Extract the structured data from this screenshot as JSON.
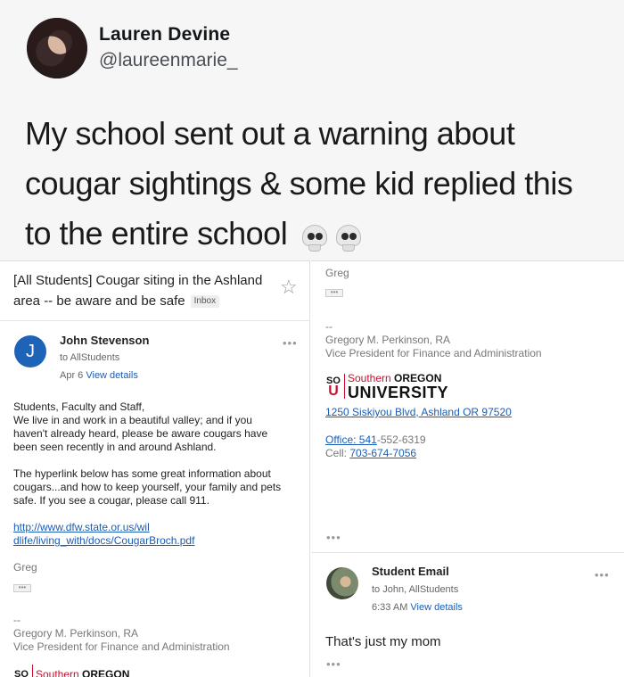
{
  "tweet": {
    "author_name": "Lauren Devine",
    "author_handle": "@laureenmarie_",
    "text_line1": "My school sent out a warning about",
    "text_line2": "cougar sightings & some kid replied this",
    "text_line3": "to the entire school",
    "emoji": "skull-emoji"
  },
  "email": {
    "subject": "[All Students] Cougar siting in the Ashland area -- be aware and be safe",
    "label": "Inbox",
    "sender_initial": "J",
    "sender_name": "John Stevenson",
    "to": "to AllStudents",
    "date": "Apr 6",
    "details_link": "View details",
    "body_p1": [
      "Students, Faculty and Staff,",
      "We live in and work in a beautiful valley; and if you",
      "haven't already heard, please be aware cougars have",
      "been seen recently in and around Ashland."
    ],
    "body_p2": [
      "The hyperlink below has some great information about",
      "cougars...and how to keep yourself, your family and pets",
      "safe.  If you see a cougar, please call 911."
    ],
    "url_line1": "http://www.dfw.state.or.us/wil",
    "url_line2": "dlife/living_with/docs/CougarBroch.pdf",
    "sign_off": "Greg",
    "sig_dash": "--",
    "sig_name": "Gregory M. Perkinson, RA",
    "sig_title": "Vice President for Finance and Administration",
    "logo_mark_top": "SO",
    "logo_mark_bottom": "U",
    "logo_line1_a": "Southern",
    "logo_line1_b": "OREGON",
    "logo_line2": "UNIVERSITY",
    "address": "1250 Siskiyou Blvd, Ashland  OR 97520",
    "office_label": "Office: ",
    "office_link": "541",
    "office_rest": "-552-6319",
    "cell_label": "Cell:  ",
    "cell_number": "703-674-7056",
    "ellipsis": "•••"
  },
  "reply": {
    "sender_name": "Student Email",
    "to": "to John, AllStudents",
    "time": "6:33 AM",
    "details_link": "View details",
    "text": "That's just my mom"
  },
  "colors": {
    "link": "#1a5db8",
    "avatar_blue": "#1d63b8",
    "brand_red": "#c8102e"
  }
}
